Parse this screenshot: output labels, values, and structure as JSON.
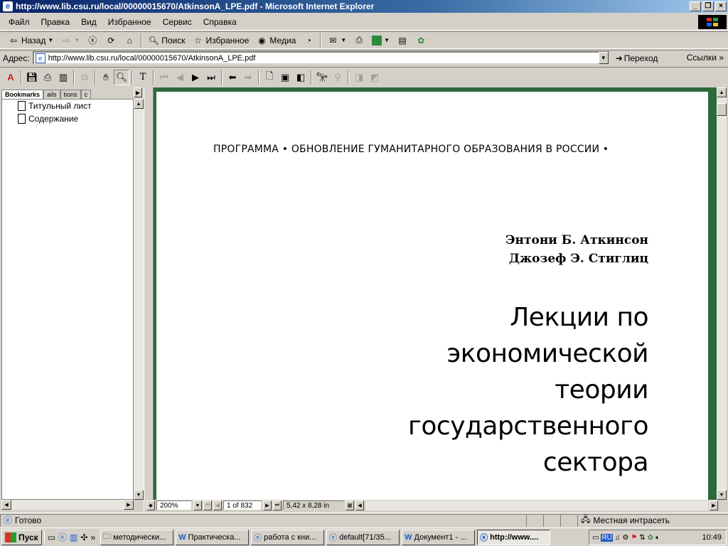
{
  "window": {
    "title": "http://www.lib.csu.ru/local/00000015670/AtkinsonA_LPE.pdf - Microsoft Internet Explorer"
  },
  "menu": [
    "Файл",
    "Правка",
    "Вид",
    "Избранное",
    "Сервис",
    "Справка"
  ],
  "toolbar": {
    "back": "Назад",
    "search": "Поиск",
    "favorites": "Избранное",
    "media": "Медиа"
  },
  "address": {
    "label": "Адрес:",
    "url": "http://www.lib.csu.ru/local/00000015670/AtkinsonA_LPE.pdf",
    "go": "Переход",
    "links": "Ссылки"
  },
  "navpane": {
    "tabs": [
      "Bookmarks",
      "ails",
      "tions",
      "c"
    ],
    "bookmarks": [
      "Титульный лист",
      "Содержание"
    ]
  },
  "document": {
    "series": "ПРОГРАММА • ОБНОВЛЕНИЕ ГУМАНИТАРНОГО ОБРАЗОВАНИЯ В РОССИИ •",
    "author1": "Энтони Б. Аткинсон",
    "author2": "Джозеф Э. Стиглиц",
    "title_lines": [
      "Лекции по",
      "экономической",
      "теории",
      "государственного",
      "сектора"
    ]
  },
  "acro_status": {
    "zoom": "200%",
    "page": "1 of 832",
    "size": "5,42 x 8,28 in"
  },
  "ie_status": {
    "text": "Готово",
    "zone": "Местная интрасеть"
  },
  "taskbar": {
    "start": "Пуск",
    "tasks": [
      "методически...",
      "Практическа...",
      "работа с кни...",
      "default[71/35...",
      "Документ1 - ...",
      "http://www...."
    ],
    "lang": "RU",
    "clock": "10:49"
  }
}
